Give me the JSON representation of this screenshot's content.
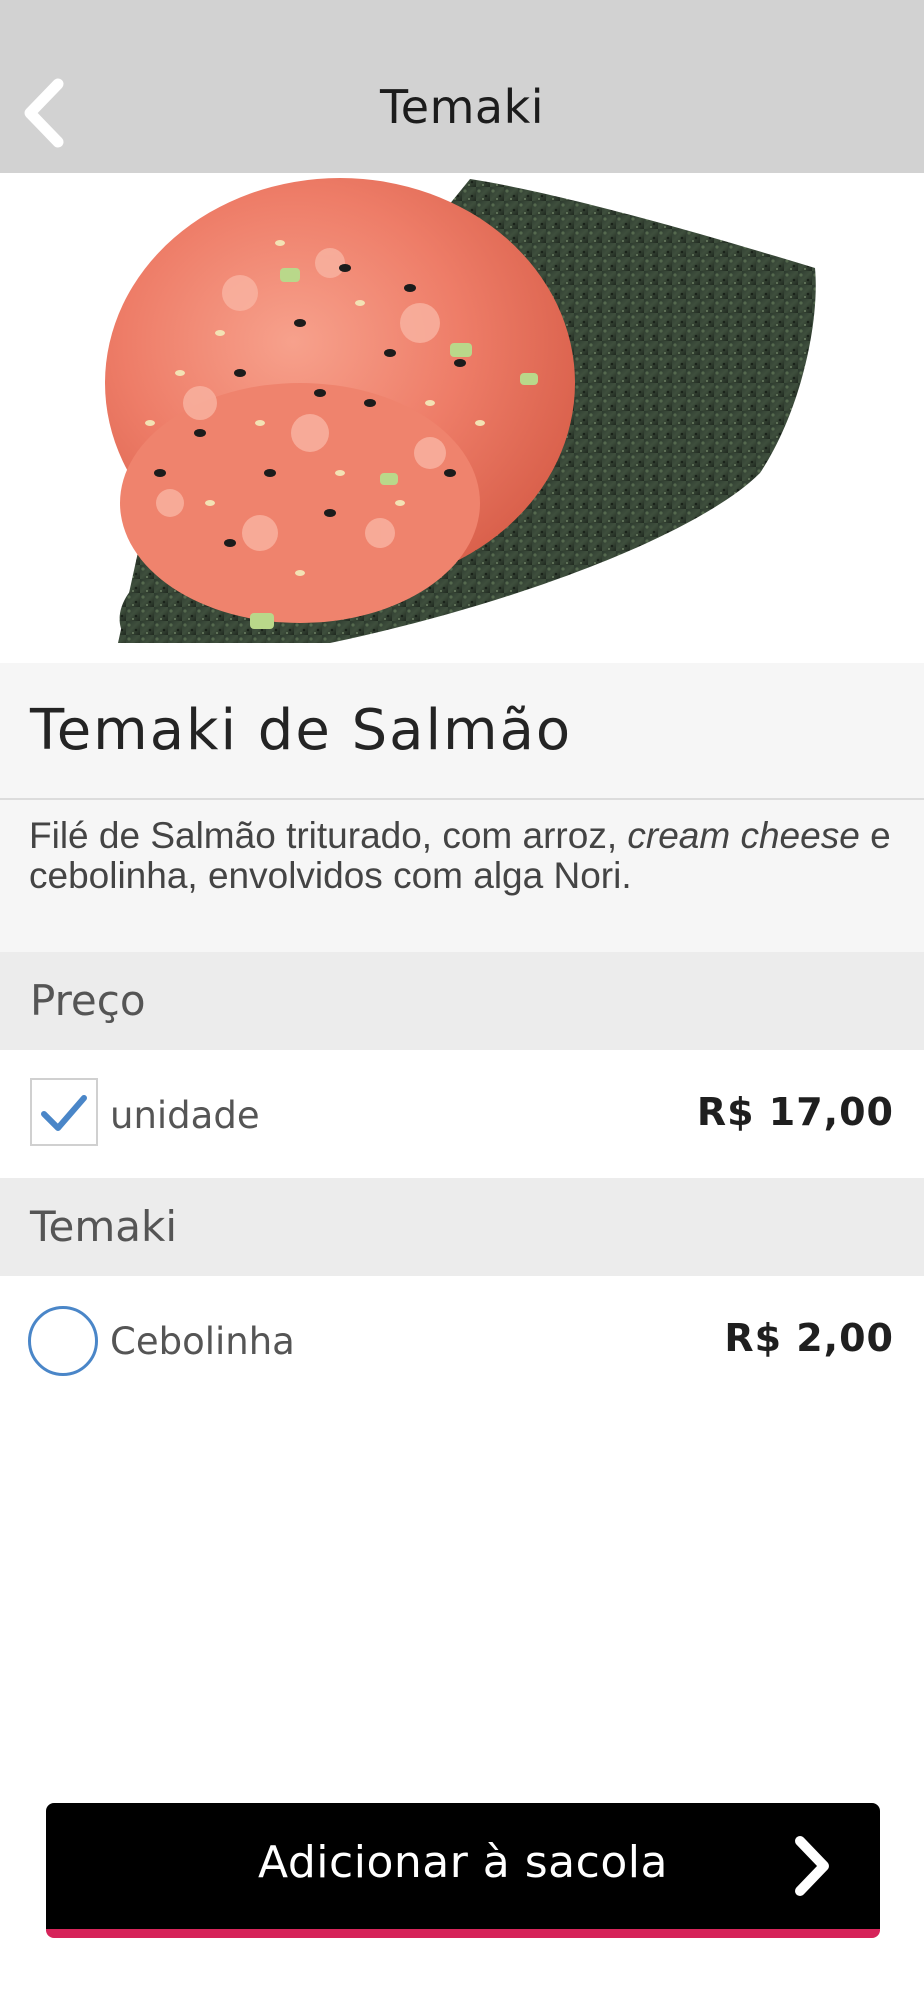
{
  "header": {
    "title": "Temaki",
    "back_icon": "chevron-left-icon"
  },
  "hero": {
    "image": "temaki-salmon-photo"
  },
  "product": {
    "name": "Temaki de Salmão",
    "description_part1": "Filé de Salmão triturado, com arroz, ",
    "description_italic1": "cream cheese",
    "description_part2": " e cebolinha, envolvidos com alga Nori."
  },
  "sections": [
    {
      "title": "Preço",
      "options": [
        {
          "label": "unidade",
          "price": "R$ 17,00",
          "control": "checkbox",
          "checked": true
        }
      ]
    },
    {
      "title": "Temaki",
      "options": [
        {
          "label": "Cebolinha",
          "price": "R$ 2,00",
          "control": "radio",
          "checked": false
        }
      ]
    }
  ],
  "cta": {
    "label": "Adicionar à sacola",
    "icon": "chevron-right-icon"
  },
  "colors": {
    "header_bg": "#d2d2d2",
    "accent_blue": "#4a86c8",
    "cta_bg": "#000000",
    "cta_underline": "#d6245a"
  }
}
